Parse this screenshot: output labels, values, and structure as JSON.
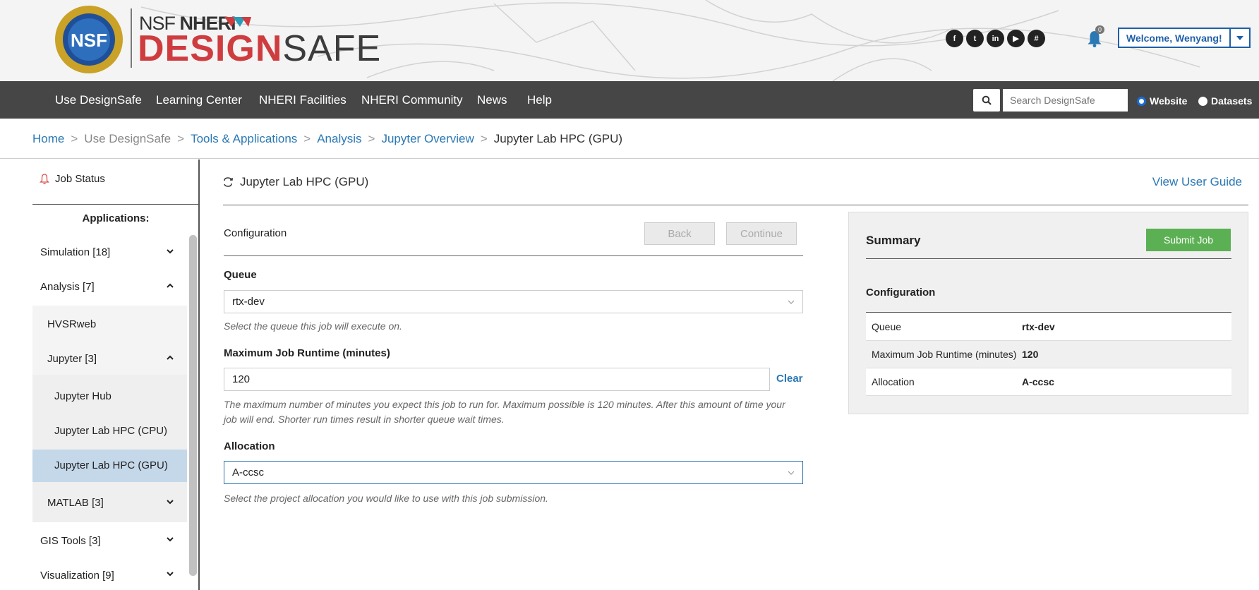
{
  "header": {
    "logo_nsf": "NSF",
    "logo_nheri": "NHERI",
    "logo_design": "DESIGN",
    "logo_safe": "SAFE",
    "social": [
      "facebook-icon",
      "twitter-icon",
      "linkedin-icon",
      "youtube-icon",
      "slack-icon"
    ],
    "notifications_count": "0",
    "welcome": "Welcome, Wenyang!"
  },
  "nav": {
    "items": [
      "Use DesignSafe",
      "Learning Center",
      "NHERI Facilities",
      "NHERI Community",
      "News",
      "Help"
    ],
    "search_placeholder": "Search DesignSafe",
    "radio_website": "Website",
    "radio_datasets": "Datasets"
  },
  "breadcrumb": {
    "items": [
      "Home",
      "Use DesignSafe",
      "Tools & Applications",
      "Analysis",
      "Jupyter Overview",
      "Jupyter Lab HPC (GPU)"
    ],
    "sep": ">"
  },
  "sidebar": {
    "job_status": "Job Status",
    "applications": "Applications:",
    "items": [
      "Simulation [18]",
      "Analysis [7]",
      "HVSRweb",
      "Jupyter [3]",
      "Jupyter Hub",
      "Jupyter Lab HPC (CPU)",
      "Jupyter Lab HPC (GPU)",
      "MATLAB [3]",
      "GIS Tools [3]",
      "Visualization [9]"
    ]
  },
  "main": {
    "title": "Jupyter Lab HPC (GPU)",
    "user_guide": "View User Guide",
    "config_title": "Configuration",
    "back": "Back",
    "continue": "Continue",
    "queue_label": "Queue",
    "queue_value": "rtx-dev",
    "queue_help": "Select the queue this job will execute on.",
    "runtime_label": "Maximum Job Runtime (minutes)",
    "runtime_value": "120",
    "clear": "Clear",
    "runtime_help_1": "The maximum number of minutes you expect this job to run for. Maximum possible is 120 minutes. After this amount of time your",
    "runtime_help_2": "job will end. Shorter run times result in shorter queue wait times.",
    "allocation_label": "Allocation",
    "allocation_value": "A-ccsc",
    "allocation_help": "Select the project allocation you would like to use with this job submission."
  },
  "summary": {
    "title": "Summary",
    "submit": "Submit Job",
    "config": "Configuration",
    "rows": [
      {
        "k": "Queue",
        "v": "rtx-dev"
      },
      {
        "k": "Maximum Job Runtime (minutes)",
        "v": "120"
      },
      {
        "k": "Allocation",
        "v": "A-ccsc"
      }
    ]
  },
  "colors": {
    "accent": "#2a78b4",
    "nav_bg": "#464646",
    "submit_green": "#5cb054",
    "logo_red": "#cf3c3f",
    "active_item": "#c5d8ea"
  }
}
